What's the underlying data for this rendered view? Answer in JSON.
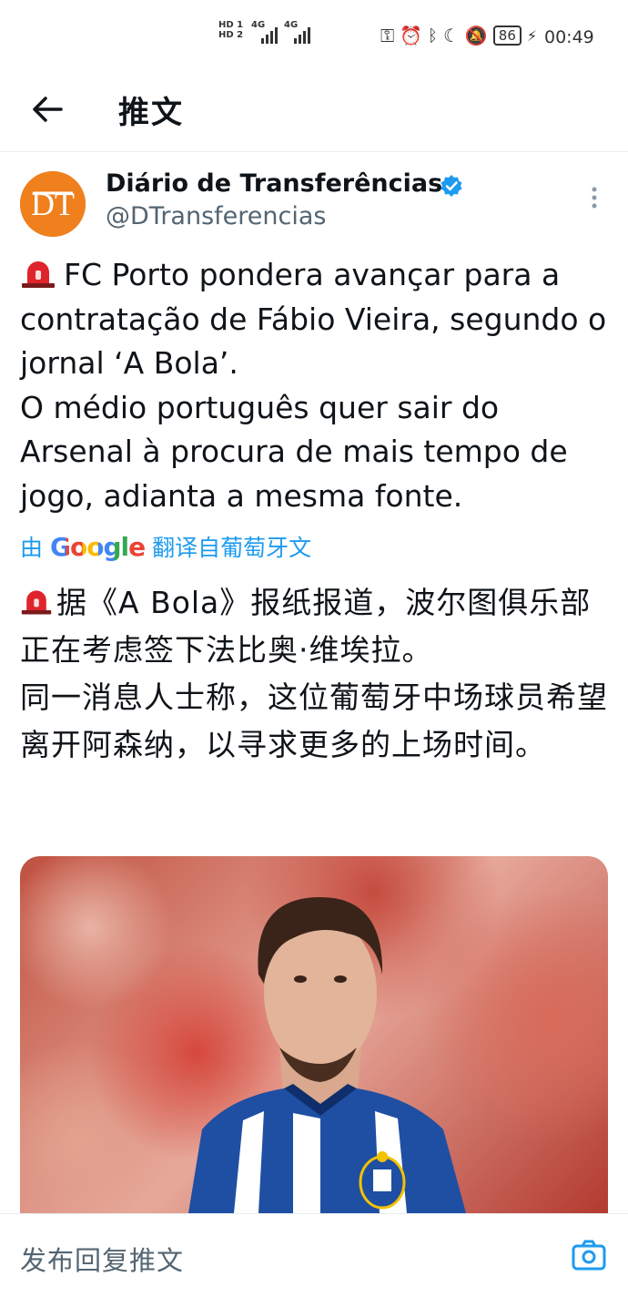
{
  "status_bar": {
    "sim_labels": "HD 1\nHD 2",
    "net1": "4G",
    "net2": "4G",
    "battery": "86",
    "time": "00:49"
  },
  "header": {
    "title": "推文"
  },
  "tweet": {
    "author_name": "Diário de Transferências",
    "handle": "@DTransferencias",
    "avatar_text": "DT",
    "text": "FC Porto pondera avançar para a contratação de Fábio Vieira, segundo o jornal ‘A Bola’.\nO médio português quer sair do Arsenal à procura de mais tempo de jogo, adianta a mesma fonte.",
    "translate_prefix": "由",
    "translate_brand": "Google",
    "translate_suffix": "翻译自葡萄牙文",
    "translated_text": "据《A Bola》报纸报道，波尔图俱乐部正在考虑签下法比奥·维埃拉。\n同一消息人士称，这位葡萄牙中场球员希望离开阿森纳，以寻求更多的上场时间。"
  },
  "reply": {
    "placeholder": "发布回复推文"
  },
  "colors": {
    "accent": "#1d9bf0",
    "avatar": "#f07f1e",
    "porto_blue": "#1f4fa3"
  },
  "icons": [
    "back-arrow-icon",
    "verified-badge-icon",
    "more-options-icon",
    "siren-icon",
    "camera-icon"
  ]
}
